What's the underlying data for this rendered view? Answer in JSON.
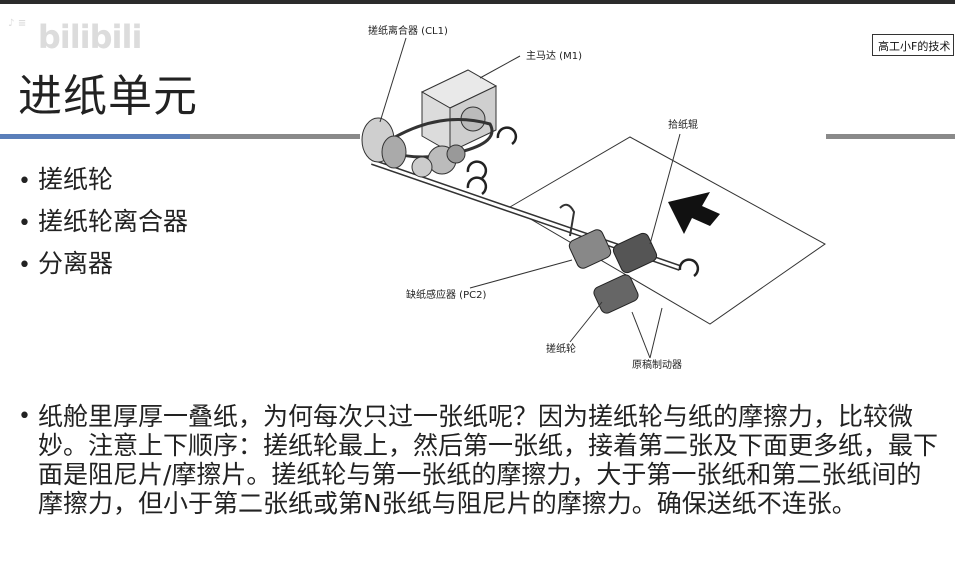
{
  "watermark": {
    "small": "♪ ≡",
    "logo": "bilibili"
  },
  "slide": {
    "title": "进纸单元",
    "channel_tag": "高工小F的技术",
    "bullets": [
      "搓纸轮",
      "搓纸轮离合器",
      "分离器"
    ],
    "bullet_char": "•",
    "paragraph": "纸舱里厚厚一叠纸，为何每次只过一张纸呢？因为搓纸轮与纸的摩擦力，比较微妙。注意上下顺序：搓纸轮最上，然后第一张纸，接着第二张及下面更多纸，最下面是阻尼片/摩擦片。搓纸轮与第一张纸的摩擦力，大于第一张纸和第二张纸间的摩擦力，但小于第二张纸或第N张纸与阻尼片的摩擦力。确保送纸不连张。"
  },
  "diagram": {
    "labels": {
      "clutch": "搓纸离合器 (CL1)",
      "motor": "主马达 (M1)",
      "pickup_roller": "拾纸辊",
      "sensor": "缺纸感应器 (PC2)",
      "feed_roller": "搓纸轮",
      "doc_stopper": "原稿制动器"
    }
  },
  "colors": {
    "accent_blue": "#5a7fba",
    "rule_gray": "#8a8a8a",
    "text": "#222222"
  }
}
